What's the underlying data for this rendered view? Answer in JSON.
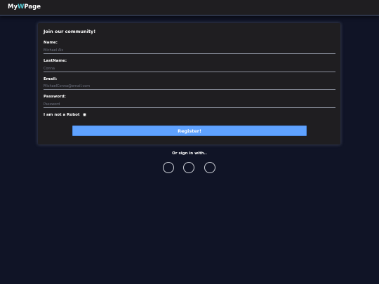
{
  "navbar": {
    "brand_prefix": "My",
    "brand_accent": "W",
    "brand_suffix": "Page",
    "accent_color": "#56ccd6"
  },
  "form": {
    "title": "Join our community!",
    "fields": [
      {
        "label": "Name:",
        "placeholder": "Michael Als",
        "value": ""
      },
      {
        "label": "LastName:",
        "placeholder": "Conna",
        "value": ""
      },
      {
        "label": "Email:",
        "placeholder": "MichaelConna@email.com",
        "value": ""
      },
      {
        "label": "Password:",
        "placeholder": "Password",
        "value": ""
      }
    ],
    "robot_label": "I am not a Robot",
    "robot_checked": false,
    "register_label": "Register!",
    "register_color": "#5fa2ff"
  },
  "social": {
    "prompt": "Or sign in with..",
    "buttons": [
      "social-circle-icon",
      "social-circle-icon",
      "social-circle-icon"
    ]
  }
}
